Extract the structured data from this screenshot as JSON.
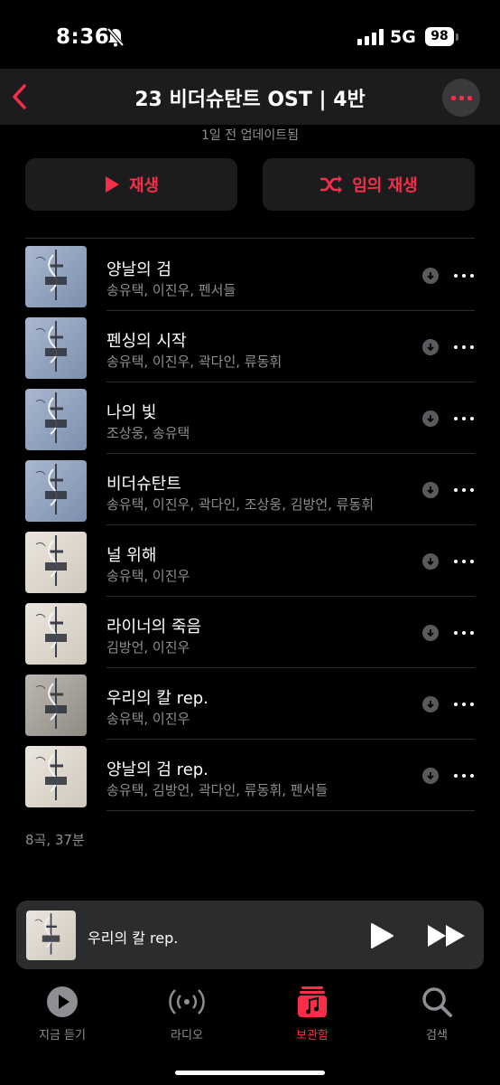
{
  "status": {
    "time": "8:36",
    "network": "5G",
    "battery": "98"
  },
  "header": {
    "title": "23 비더슈탄트 OST | 4반",
    "back_icon": "chevron-left-icon",
    "more_icon": "ellipsis-icon"
  },
  "updated": "1일 전 업데이트됨",
  "buttons": {
    "play": "재생",
    "shuffle": "임의 재생"
  },
  "colors": {
    "accent": "#fa2d48",
    "background": "#000000",
    "secondary_text": "#8e8e93"
  },
  "tracks": [
    {
      "title": "양날의 검",
      "artists": "송유택, 이진우, 펜서들",
      "art": "blue"
    },
    {
      "title": "펜싱의 시작",
      "artists": "송유택, 이진우, 곽다인, 류동휘",
      "art": "blue"
    },
    {
      "title": "나의 빛",
      "artists": "조상웅, 송유택",
      "art": "blue"
    },
    {
      "title": "비더슈탄트",
      "artists": "송유택, 이진우, 곽다인, 조상웅, 김방언, 류동휘",
      "art": "blue"
    },
    {
      "title": "널 위해",
      "artists": "송유택, 이진우",
      "art": "cream"
    },
    {
      "title": "라이너의 죽음",
      "artists": "김방언, 이진우",
      "art": "cream"
    },
    {
      "title": "우리의 칼 rep.",
      "artists": "송유택, 이진우",
      "art": "grey"
    },
    {
      "title": "양날의 검 rep.",
      "artists": "송유택, 김방언, 곽다인, 류동휘, 펜서들",
      "art": "cream"
    }
  ],
  "summary": "8곡, 37분",
  "now_playing": {
    "title": "우리의 칼 rep."
  },
  "tabs": [
    {
      "label": "지금 듣기",
      "icon": "play-circle-icon",
      "active": false
    },
    {
      "label": "라디오",
      "icon": "radio-waves-icon",
      "active": false
    },
    {
      "label": "보관함",
      "icon": "library-icon",
      "active": true
    },
    {
      "label": "검색",
      "icon": "search-icon",
      "active": false
    }
  ]
}
